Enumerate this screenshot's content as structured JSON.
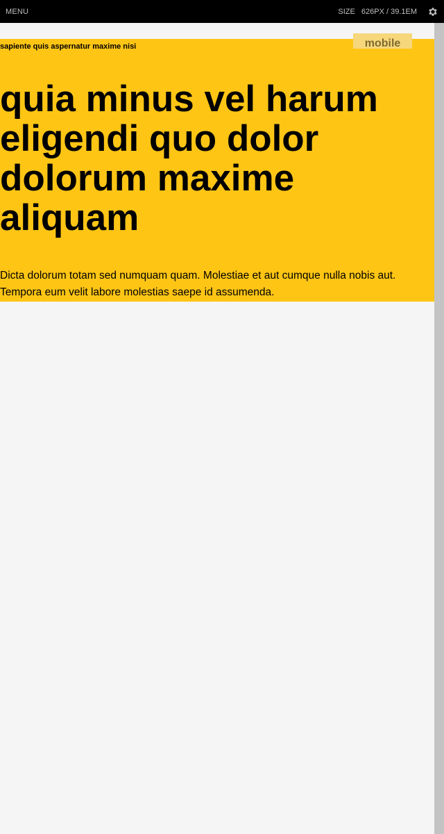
{
  "toolbar": {
    "menu_label": "MENU",
    "size_label": "SIZE",
    "size_value": "626PX / 39.1EM",
    "settings_icon": "gear-icon"
  },
  "breakpoint": {
    "label": "mobile"
  },
  "hero": {
    "kicker": "sapiente quis aspernatur maxime nisi",
    "headline": "quia minus vel harum eligendi quo dolor dolorum maxime aliquam",
    "lead": "Dicta dolorum totam sed numquam quam. Molestiae et aut cumque nulla nobis aut. Tempora eum velit labore molestias saepe id assumenda."
  },
  "colors": {
    "hero_background": "#fec515",
    "toolbar_background": "#000000",
    "page_background": "#f5f5f5",
    "badge_background": "#f6d77c"
  }
}
